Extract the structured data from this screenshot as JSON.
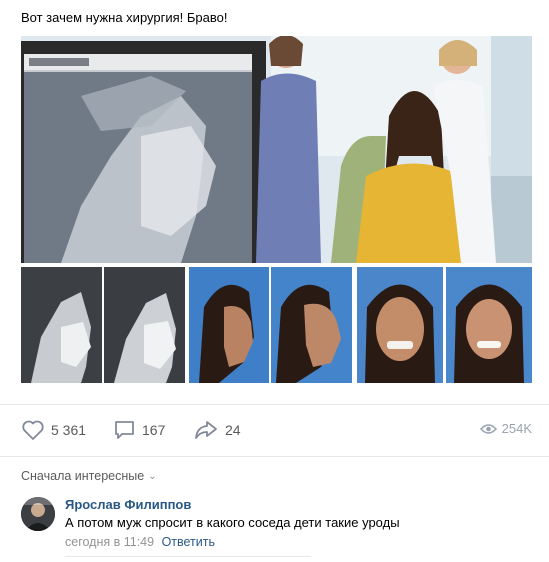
{
  "post": {
    "text": "Вот зачем нужна хирургия! Браво!"
  },
  "actions": {
    "likes": "5 361",
    "comments": "167",
    "shares": "24",
    "views": "254K"
  },
  "comments_section": {
    "sort_label": "Сначала интересные",
    "comment": {
      "author": "Ярослав Филиппов",
      "text": "А потом муж спросит в какого соседа дети такие уроды",
      "time": "сегодня в 11:49",
      "reply_label": "Ответить"
    }
  },
  "colors": {
    "link": "#2a5885",
    "muted": "#939393",
    "action_text": "#5b5b5b",
    "icon": "#828a99"
  }
}
